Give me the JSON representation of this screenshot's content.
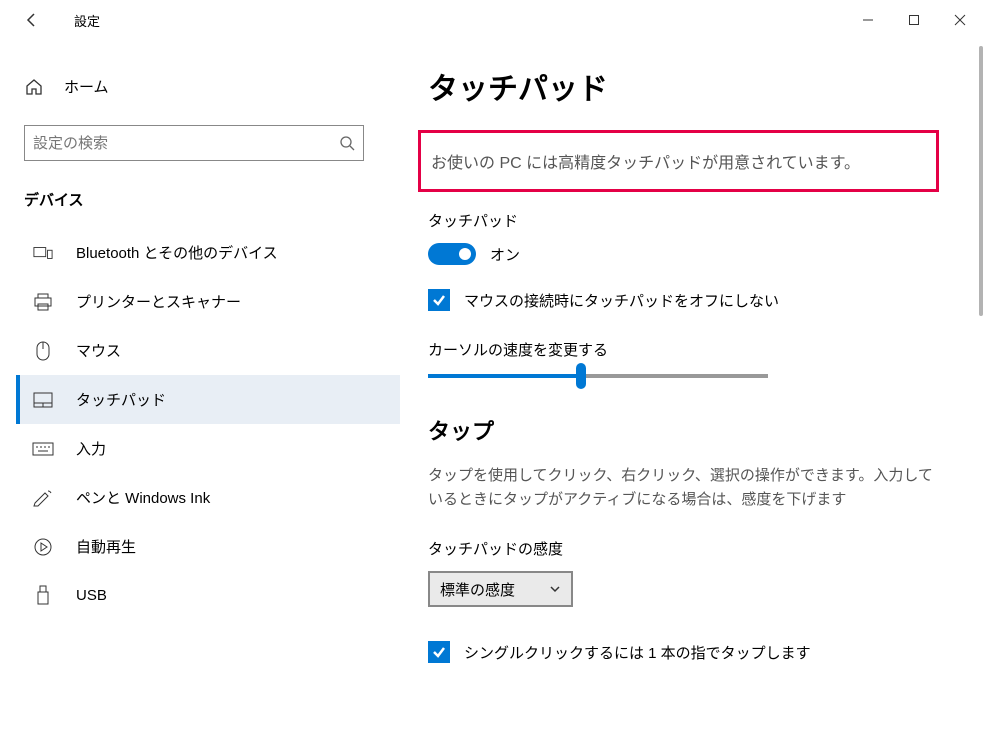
{
  "window": {
    "title": "設定"
  },
  "sidebar": {
    "home_label": "ホーム",
    "search_placeholder": "設定の検索",
    "category": "デバイス",
    "items": [
      {
        "label": "Bluetooth とその他のデバイス"
      },
      {
        "label": "プリンターとスキャナー"
      },
      {
        "label": "マウス"
      },
      {
        "label": "タッチパッド"
      },
      {
        "label": "入力"
      },
      {
        "label": "ペンと Windows Ink"
      },
      {
        "label": "自動再生"
      },
      {
        "label": "USB"
      }
    ]
  },
  "main": {
    "title": "タッチパッド",
    "precision_notice": "お使いの PC には高精度タッチパッドが用意されています。",
    "touchpad_label": "タッチパッド",
    "toggle_state_label": "オン",
    "mouse_checkbox": "マウスの接続時にタッチパッドをオフにしない",
    "slider_label": "カーソルの速度を変更する",
    "tap_heading": "タップ",
    "tap_desc": "タップを使用してクリック、右クリック、選択の操作ができます。入力しているときにタップがアクティブになる場合は、感度を下げます",
    "sensitivity_label": "タッチパッドの感度",
    "sensitivity_value": "標準の感度",
    "single_click_checkbox": "シングルクリックするには 1 本の指でタップします"
  }
}
